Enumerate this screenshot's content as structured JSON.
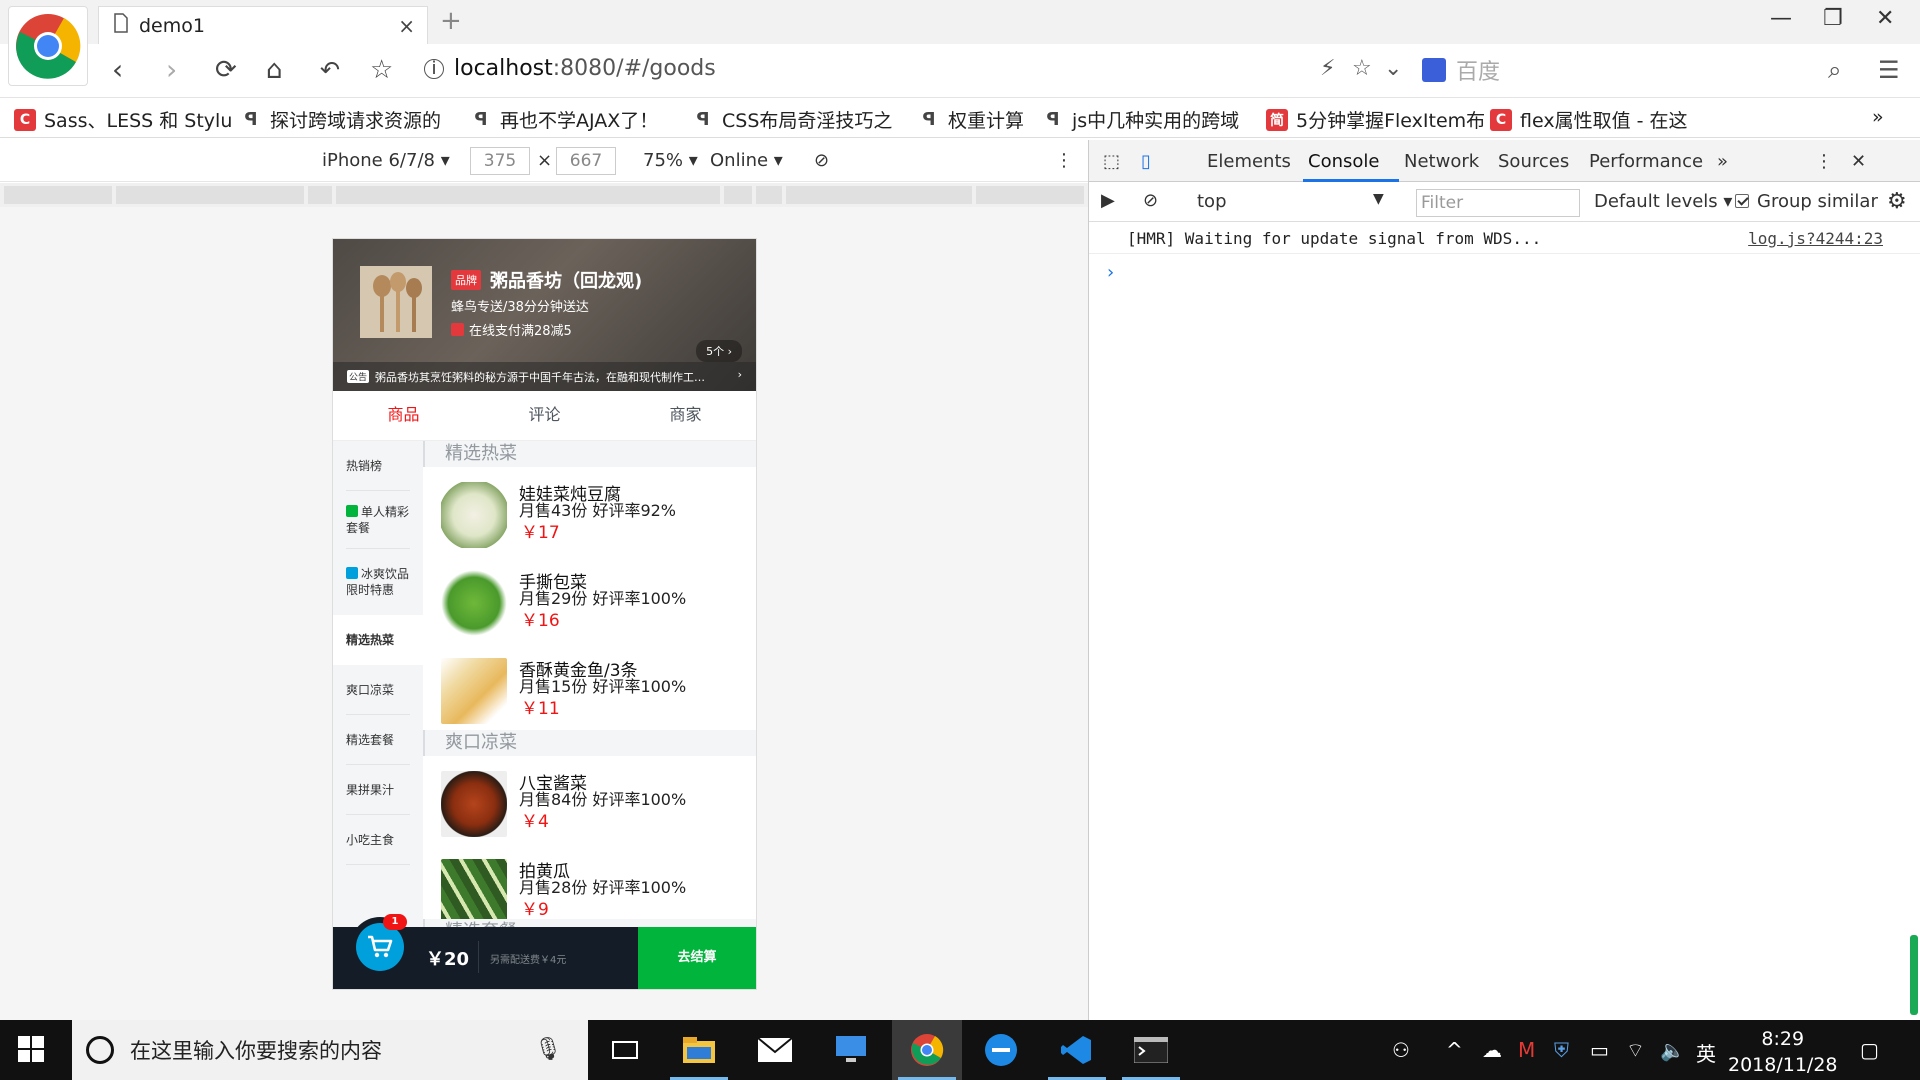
{
  "browser": {
    "tab_title": "demo1",
    "close_glyph": "×",
    "new_tab_glyph": "+",
    "url_host": "localhost",
    "url_path": ":8080/#/goods",
    "search_engine": "百度",
    "bookmarks": [
      {
        "label": "Sass、LESS 和 Stylu",
        "icon": "c-icon",
        "color": "#e4393c"
      },
      {
        "label": "探讨跨域请求资源的",
        "icon": "feather-icon",
        "color": "#555555"
      },
      {
        "label": "再也不学AJAX了！",
        "icon": "feather-icon",
        "color": "#555555"
      },
      {
        "label": "CSS布局奇淫技巧之",
        "icon": "feather-icon",
        "color": "#555555"
      },
      {
        "label": "权重计算",
        "icon": "feather-icon",
        "color": "#555555"
      },
      {
        "label": "js中几种实用的跨域",
        "icon": "feather-icon",
        "color": "#555555"
      },
      {
        "label": "5分钟掌握FlexItem布",
        "icon": "jian-icon",
        "color": "#e4393c"
      },
      {
        "label": "flex属性取值 - 在这",
        "icon": "c-icon",
        "color": "#e4393c"
      }
    ],
    "more_glyph": "»"
  },
  "device_toolbar": {
    "device": "iPhone 6/7/8",
    "width": "375",
    "height": "667",
    "times": "×",
    "zoom": "75%",
    "network": "Online"
  },
  "app": {
    "brand_tag": "品牌",
    "shop_name": "粥品香坊（回龙观)",
    "delivery": "蜂鸟专送/38分分钟送达",
    "activity": "在线支付满28减5",
    "support_count": "5个 ›",
    "bulletin_tag": "公告",
    "bulletin": "粥品香坊其烹饪粥料的秘方源于中国千年古法，在融和现代制作工…",
    "bulletin_arrow": "›",
    "tabs": [
      "商品",
      "评论",
      "商家"
    ],
    "menu": [
      {
        "label": "热销榜",
        "icon": ""
      },
      {
        "label": "单人精彩套餐",
        "icon": "special-icon"
      },
      {
        "label": "冰爽饮品限时特惠",
        "icon": "discount-icon"
      },
      {
        "label": "精选热菜",
        "icon": ""
      },
      {
        "label": "爽口凉菜",
        "icon": ""
      },
      {
        "label": "精选套餐",
        "icon": ""
      },
      {
        "label": "果拼果汁",
        "icon": ""
      },
      {
        "label": "小吃主食",
        "icon": ""
      }
    ],
    "sections": [
      {
        "title": "精选热菜",
        "foods": [
          {
            "name": "娃娃菜炖豆腐",
            "sell": "月售43份 好评率92%",
            "price": "￥17"
          },
          {
            "name": "手撕包菜",
            "sell": "月售29份 好评率100%",
            "price": "￥16"
          },
          {
            "name": "香酥黄金鱼/3条",
            "sell": "月售15份 好评率100%",
            "price": "￥11"
          }
        ]
      },
      {
        "title": "爽口凉菜",
        "foods": [
          {
            "name": "八宝酱菜",
            "sell": "月售84份 好评率100%",
            "price": "￥4"
          },
          {
            "name": "拍黄瓜",
            "sell": "月售28份 好评率100%",
            "price": "￥9"
          }
        ]
      },
      {
        "title": "精选套餐",
        "foods": []
      }
    ],
    "cart": {
      "count": "1",
      "total": "￥20",
      "delivery_fee": "另需配送费￥4元",
      "checkout": "去结算"
    }
  },
  "devtools": {
    "tabs": [
      "Elements",
      "Console",
      "Network",
      "Sources",
      "Performance"
    ],
    "more_glyph": "»",
    "context": "top",
    "filter_placeholder": "Filter",
    "levels": "Default levels",
    "group_similar": "Group similar",
    "log_message": "[HMR] Waiting for update signal from WDS...",
    "log_source": "log.js?4244:23",
    "prompt": "›"
  },
  "taskbar": {
    "search_placeholder": "在这里输入你要搜索的内容",
    "ime": "英",
    "time": "8:29",
    "date": "2018/11/28"
  },
  "colors": {
    "accent_red": "#f01414",
    "cart_bg": "#141d27",
    "checkout_green": "#00b43c",
    "devtools_blue": "#1a73e8"
  }
}
